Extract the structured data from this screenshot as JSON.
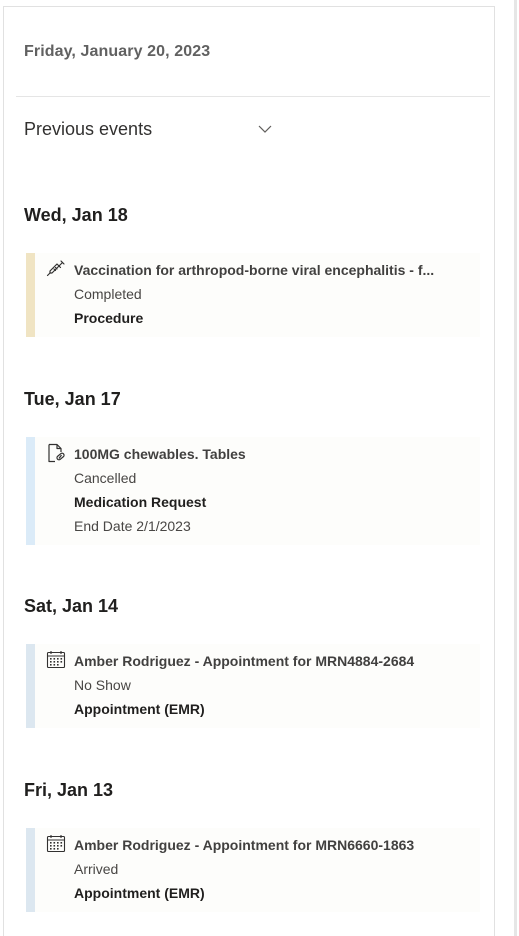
{
  "header": {
    "date": "Friday, January 20, 2023"
  },
  "filter": {
    "label": "Previous events"
  },
  "colors": {
    "procedure": "#f0e4c3",
    "medication": "#dbebf8",
    "appointment": "#dce7f0"
  },
  "groups": [
    {
      "date": "Wed, Jan 18",
      "items": [
        {
          "icon": "syringe-icon",
          "title": "Vaccination for arthropod-borne viral encephalitis - f...",
          "status": "Completed",
          "type": "Procedure",
          "extra": ""
        }
      ]
    },
    {
      "date": "Tue, Jan 17",
      "items": [
        {
          "icon": "prescription-icon",
          "title": "100MG chewables. Tables",
          "status": "Cancelled",
          "type": "Medication Request",
          "extra": "End Date 2/1/2023"
        }
      ]
    },
    {
      "date": "Sat, Jan 14",
      "items": [
        {
          "icon": "calendar-icon",
          "title": "Amber Rodriguez - Appointment for MRN4884-2684",
          "status": "No Show",
          "type": "Appointment (EMR)",
          "extra": ""
        }
      ]
    },
    {
      "date": "Fri, Jan 13",
      "items": [
        {
          "icon": "calendar-icon",
          "title": "Amber Rodriguez - Appointment for MRN6660-1863",
          "status": "Arrived",
          "type": "Appointment (EMR)",
          "extra": ""
        }
      ]
    }
  ]
}
